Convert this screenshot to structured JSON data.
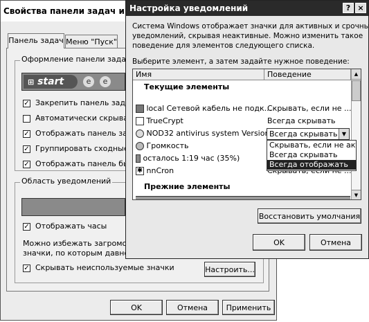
{
  "back_window": {
    "title": "Свойства панели задач и меню",
    "tabs": [
      {
        "label": "Панель задач"
      },
      {
        "label": "Меню \"Пуск\""
      }
    ],
    "group1_label": "Оформление панели задач",
    "start_label": "start",
    "checkboxes": [
      {
        "label": "Закрепить панель задач",
        "checked": true
      },
      {
        "label": "Автоматически скрывать",
        "checked": false
      },
      {
        "label": "Отображать панель задач",
        "checked": true
      },
      {
        "label": "Группировать сходные кн",
        "checked": true
      },
      {
        "label": "Отображать панель быст",
        "checked": true
      }
    ],
    "group2_label": "Область уведомлений",
    "show_clock": {
      "label": "Отображать часы",
      "checked": true
    },
    "hint_line1": "Можно избежать загроможд",
    "hint_line2": "значки, по которым давно не",
    "hide_icons": {
      "label": "Скрывать неиспользуемые значки",
      "checked": true
    },
    "configure_button": "Настроить...",
    "ok_button": "OK",
    "cancel_button": "Отмена",
    "apply_button": "Применить"
  },
  "dialog": {
    "title": "Настройка уведомлений",
    "help_button": "?",
    "close_button": "×",
    "desc_line1": "Система Windows отображает значки для активных и срочных",
    "desc_line2": "уведомлений, скрывая неактивные. Можно изменить такое",
    "desc_line3": "поведение для элементов следующего списка.",
    "select_prompt": "Выберите элемент, а затем задайте нужное поведение:",
    "col_name": "Имя",
    "col_behavior": "Поведение",
    "section_current": "Текущие элементы",
    "items": [
      {
        "name": "local Сетевой кабель не подк...",
        "behavior": "Скрывать, если не ..."
      },
      {
        "name": "TrueCrypt",
        "behavior": "Всегда скрывать"
      },
      {
        "name": "NOD32 antivirus system Version...",
        "behavior": "Всегда скрывать"
      },
      {
        "name": "Громкость",
        "behavior": ""
      },
      {
        "name": "осталось 1:19 час (35%)",
        "behavior": ""
      },
      {
        "name": "nnCron",
        "behavior": "Скрывать, если не ..."
      }
    ],
    "dropdown_options": [
      "Скрывать, если не акти",
      "Всегда скрывать",
      "Всегда отображать"
    ],
    "section_previous": "Прежние элементы",
    "restore_button": "Восстановить умолчания",
    "ok_button": "OK",
    "cancel_button": "Отмена"
  }
}
